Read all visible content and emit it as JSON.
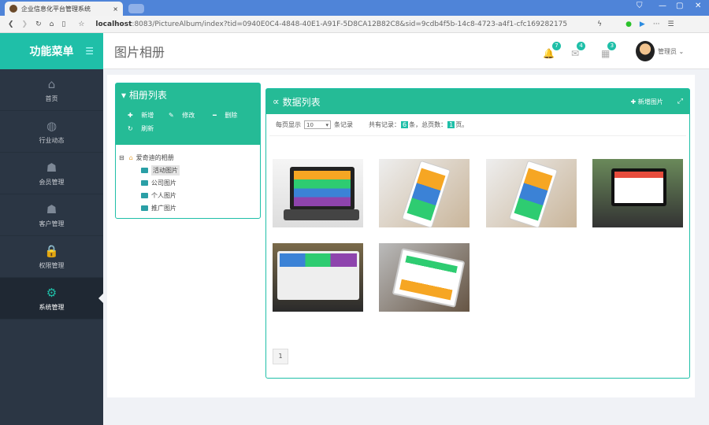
{
  "browser": {
    "tab_title": "企业信息化平台管理系统",
    "url_host": "localhost",
    "url_rest": ":8083/PictureAlbum/index?tid=0940E0C4-4848-40E1-A91F-5D8CA12B82C8&sid=9cdb4f5b-14c8-4723-a4f1-cfc169282175"
  },
  "sidebar": {
    "title": "功能菜单",
    "items": [
      {
        "label": "首页",
        "icon": "⌂"
      },
      {
        "label": "行业动态",
        "icon": "◍"
      },
      {
        "label": "会员管理",
        "icon": "☗"
      },
      {
        "label": "客户管理",
        "icon": "☗"
      },
      {
        "label": "权限管理",
        "icon": "🔒"
      },
      {
        "label": "系统管理",
        "icon": "⚙"
      }
    ]
  },
  "header": {
    "title": "图片相册",
    "badges": [
      "7",
      "4",
      "3"
    ],
    "user": "管理员"
  },
  "album": {
    "title": "相册列表",
    "add": "新增",
    "edit": "修改",
    "del": "删除",
    "refresh": "刷新",
    "root": "爱奇迪的相册",
    "folders": [
      "活动图片",
      "公司图片",
      "个人图片",
      "推广图片"
    ]
  },
  "data": {
    "title": "数据列表",
    "add": "新增图片",
    "per_page_label": "每页显示",
    "per_page": "10",
    "records_label": "条记录",
    "total_label": "共有记录：",
    "total": "6",
    "unit": "条，总页数：",
    "pages": "1",
    "page_unit": "页。",
    "page": "1"
  },
  "colors": {
    "accent": "#1fbfa8",
    "sidebar": "#2b3644"
  }
}
